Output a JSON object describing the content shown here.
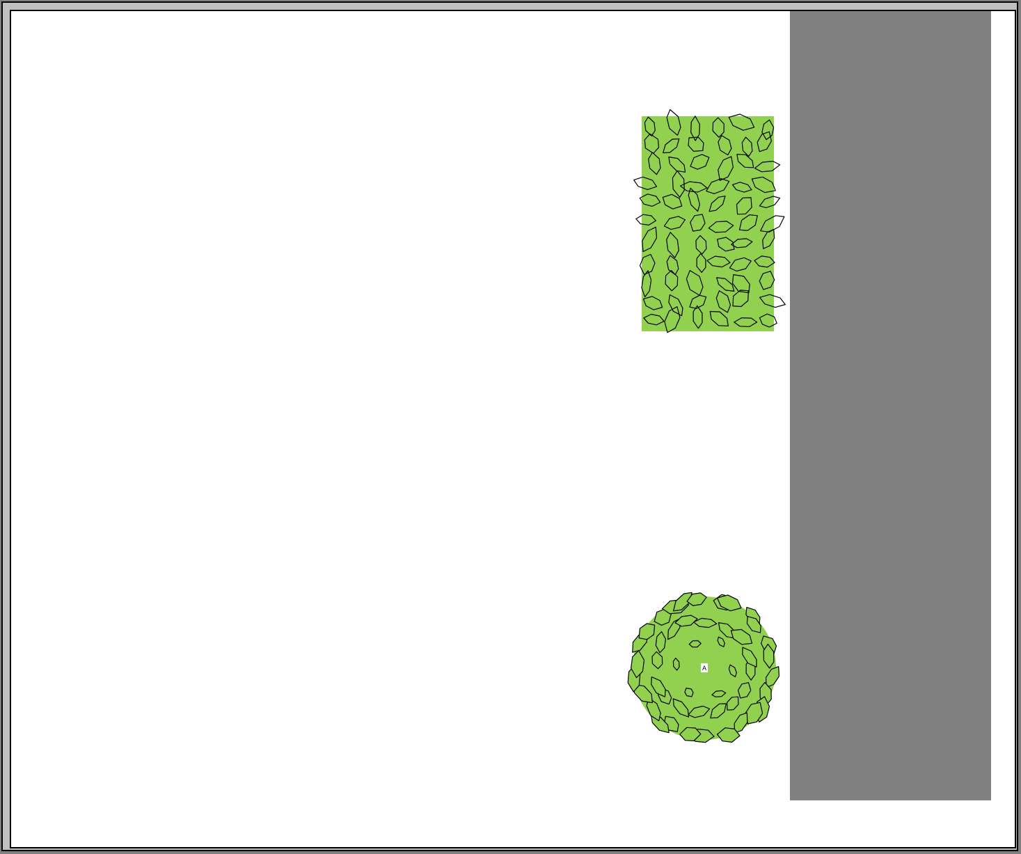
{
  "canvas": {
    "background": "#ffffff",
    "frame_color": "#808080",
    "panel_color": "#808080"
  },
  "symbols": [
    {
      "kind": "hedge-planting-rectangle",
      "fill": "#92d050",
      "stroke": "#000000"
    },
    {
      "kind": "shrub-circle",
      "fill": "#92d050",
      "stroke": "#000000",
      "label": "A"
    }
  ]
}
